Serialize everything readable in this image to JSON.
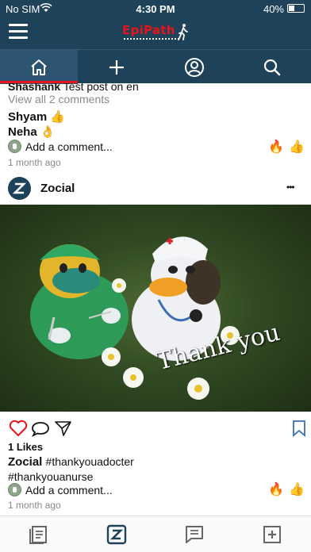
{
  "status_bar": {
    "carrier": "No SIM",
    "time": "4:30 PM",
    "battery": "40%"
  },
  "app": {
    "logo_text": "EpiPath"
  },
  "top_nav": [
    "home-icon",
    "plus-icon",
    "profile-icon",
    "search-icon"
  ],
  "prev_post": {
    "partial_comment_user": "Shashank",
    "partial_comment_text": "Test post on en",
    "view_comments": "View all 2 comments",
    "comments": [
      {
        "user": "Shyam",
        "emoji": "👍"
      },
      {
        "user": "Neha",
        "emoji": "👌"
      }
    ],
    "add_comment_placeholder": "Add a comment...",
    "quick_emojis": [
      "🔥",
      "👍"
    ],
    "time_ago": "1 month ago"
  },
  "post": {
    "author": "Zocial",
    "menu": "•••",
    "image_text": "Thank you",
    "likes": "1 Likes",
    "caption_user": "Zocial",
    "caption_tag1": "#thankyouadocter",
    "caption_tag2": "#thankyouanurse",
    "add_comment_placeholder": "Add a comment...",
    "quick_emojis": [
      "🔥",
      "👍"
    ],
    "time_ago": "1 month ago"
  },
  "colors": {
    "header_bg": "#1e4259",
    "accent_red": "#e8141c",
    "link_blue": "#3b6fb6",
    "icon_dark": "#1e4259"
  },
  "bottom_nav": [
    "feed-icon",
    "zocial-icon",
    "messages-icon",
    "add-post-icon"
  ]
}
